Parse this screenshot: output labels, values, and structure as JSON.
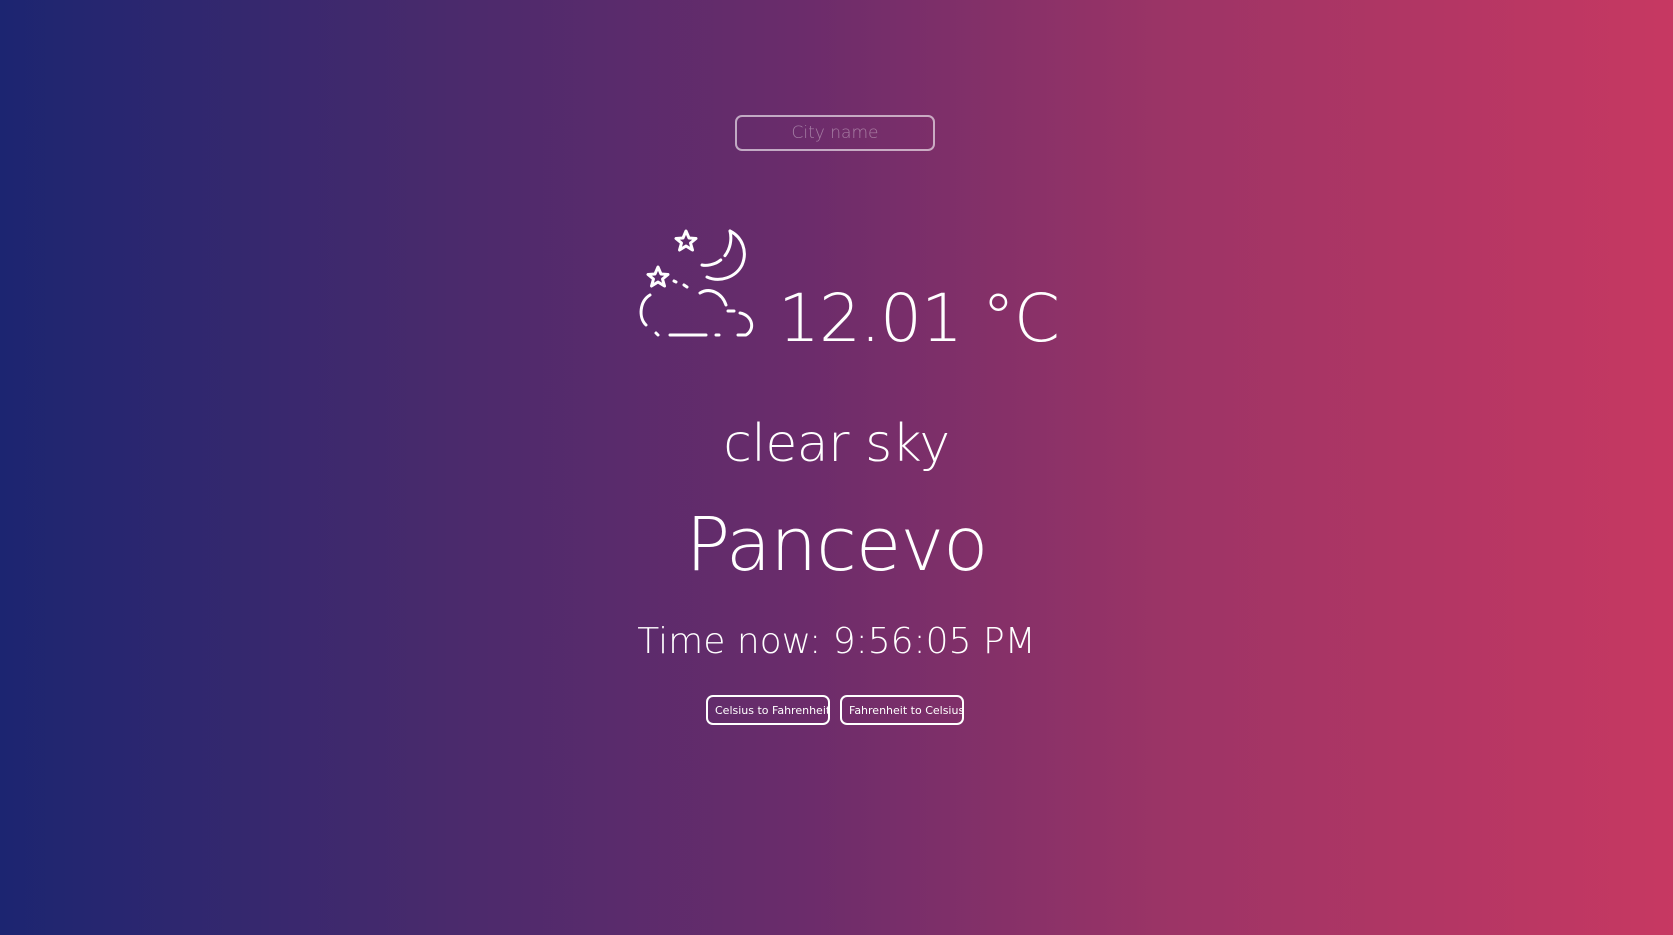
{
  "search": {
    "placeholder": "City name",
    "value": ""
  },
  "weather": {
    "icon": "night-clear-moon-stars-cloud-icon",
    "temperature": "12.01 °C",
    "description": "clear sky",
    "city": "Pancevo",
    "time_label": "Time now: 9:56:05 PM"
  },
  "buttons": {
    "celsius_to_fahrenheit": "Celsius to Fahrenheit",
    "fahrenheit_to_celsius": "Fahrenheit to Celsius"
  },
  "colors": {
    "gradient_left": "#1c2571",
    "gradient_mid": "#6b2c6b",
    "gradient_right": "#c73862",
    "text": "#ffffff"
  }
}
